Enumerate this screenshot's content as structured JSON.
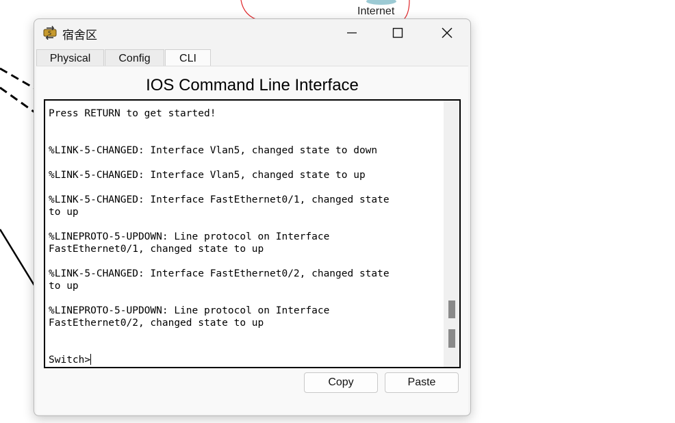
{
  "workspace": {
    "internet_label": "Internet"
  },
  "window": {
    "title": "宿舍区",
    "app_icon": "switch-device-icon",
    "controls": {
      "minimize_icon": "minimize-icon",
      "maximize_icon": "maximize-icon",
      "close_icon": "close-icon"
    }
  },
  "tabs": [
    {
      "label": "Physical",
      "active": false
    },
    {
      "label": "Config",
      "active": false
    },
    {
      "label": "CLI",
      "active": true
    }
  ],
  "cli": {
    "heading": "IOS Command Line Interface",
    "lines": [
      "Press RETURN to get started!",
      "",
      "",
      "%LINK-5-CHANGED: Interface Vlan5, changed state to down",
      "",
      "%LINK-5-CHANGED: Interface Vlan5, changed state to up",
      "",
      "%LINK-5-CHANGED: Interface FastEthernet0/1, changed state",
      "to up",
      "",
      "%LINEPROTO-5-UPDOWN: Line protocol on Interface",
      "FastEthernet0/1, changed state to up",
      "",
      "%LINK-5-CHANGED: Interface FastEthernet0/2, changed state",
      "to up",
      "",
      "%LINEPROTO-5-UPDOWN: Line protocol on Interface",
      "FastEthernet0/2, changed state to up",
      "",
      "",
      "Switch>"
    ]
  },
  "buttons": {
    "copy": "Copy",
    "paste": "Paste"
  },
  "colors": {
    "connection_line": "#000000",
    "internet_circle": "#e0262a",
    "scroll_thumb": "#8a8a8a"
  }
}
